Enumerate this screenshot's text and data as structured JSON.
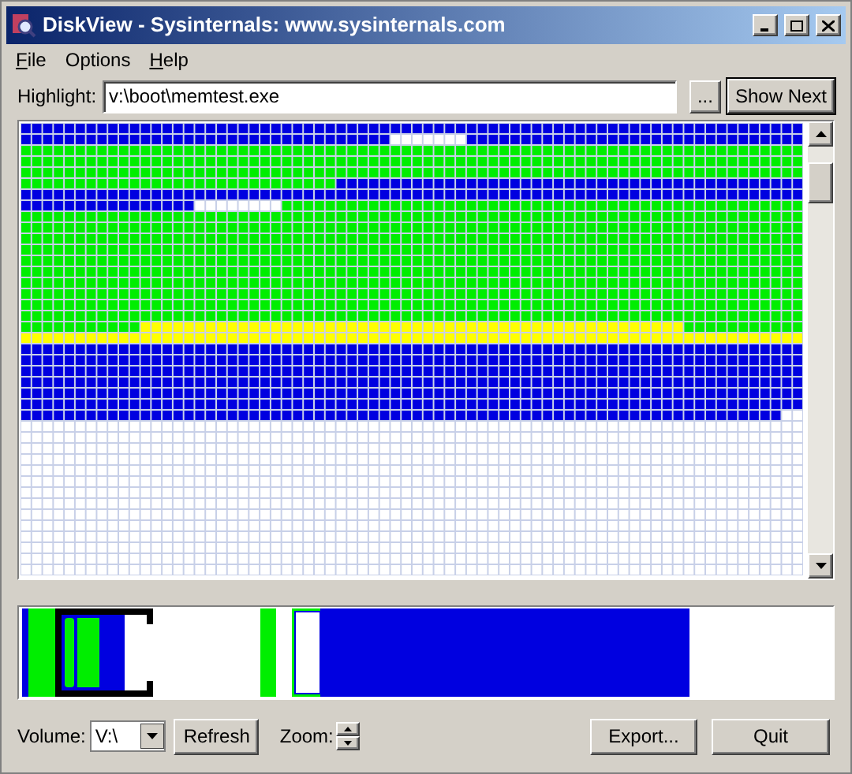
{
  "window": {
    "title": "DiskView - Sysinternals: www.sysinternals.com"
  },
  "menu": [
    {
      "label": "File",
      "underlined": true
    },
    {
      "label": "Options",
      "underlined": false
    },
    {
      "label": "Help",
      "underlined": true
    }
  ],
  "highlight": {
    "label": "Highlight:",
    "value": "v:\\boot\\memtest.exe",
    "browse": "...",
    "show_next": "Show Next"
  },
  "bottom": {
    "volume_label": "Volume:",
    "volume_value": "V:\\",
    "refresh": "Refresh",
    "zoom_label": "Zoom:",
    "export": "Export...",
    "quit": "Quit"
  }
}
